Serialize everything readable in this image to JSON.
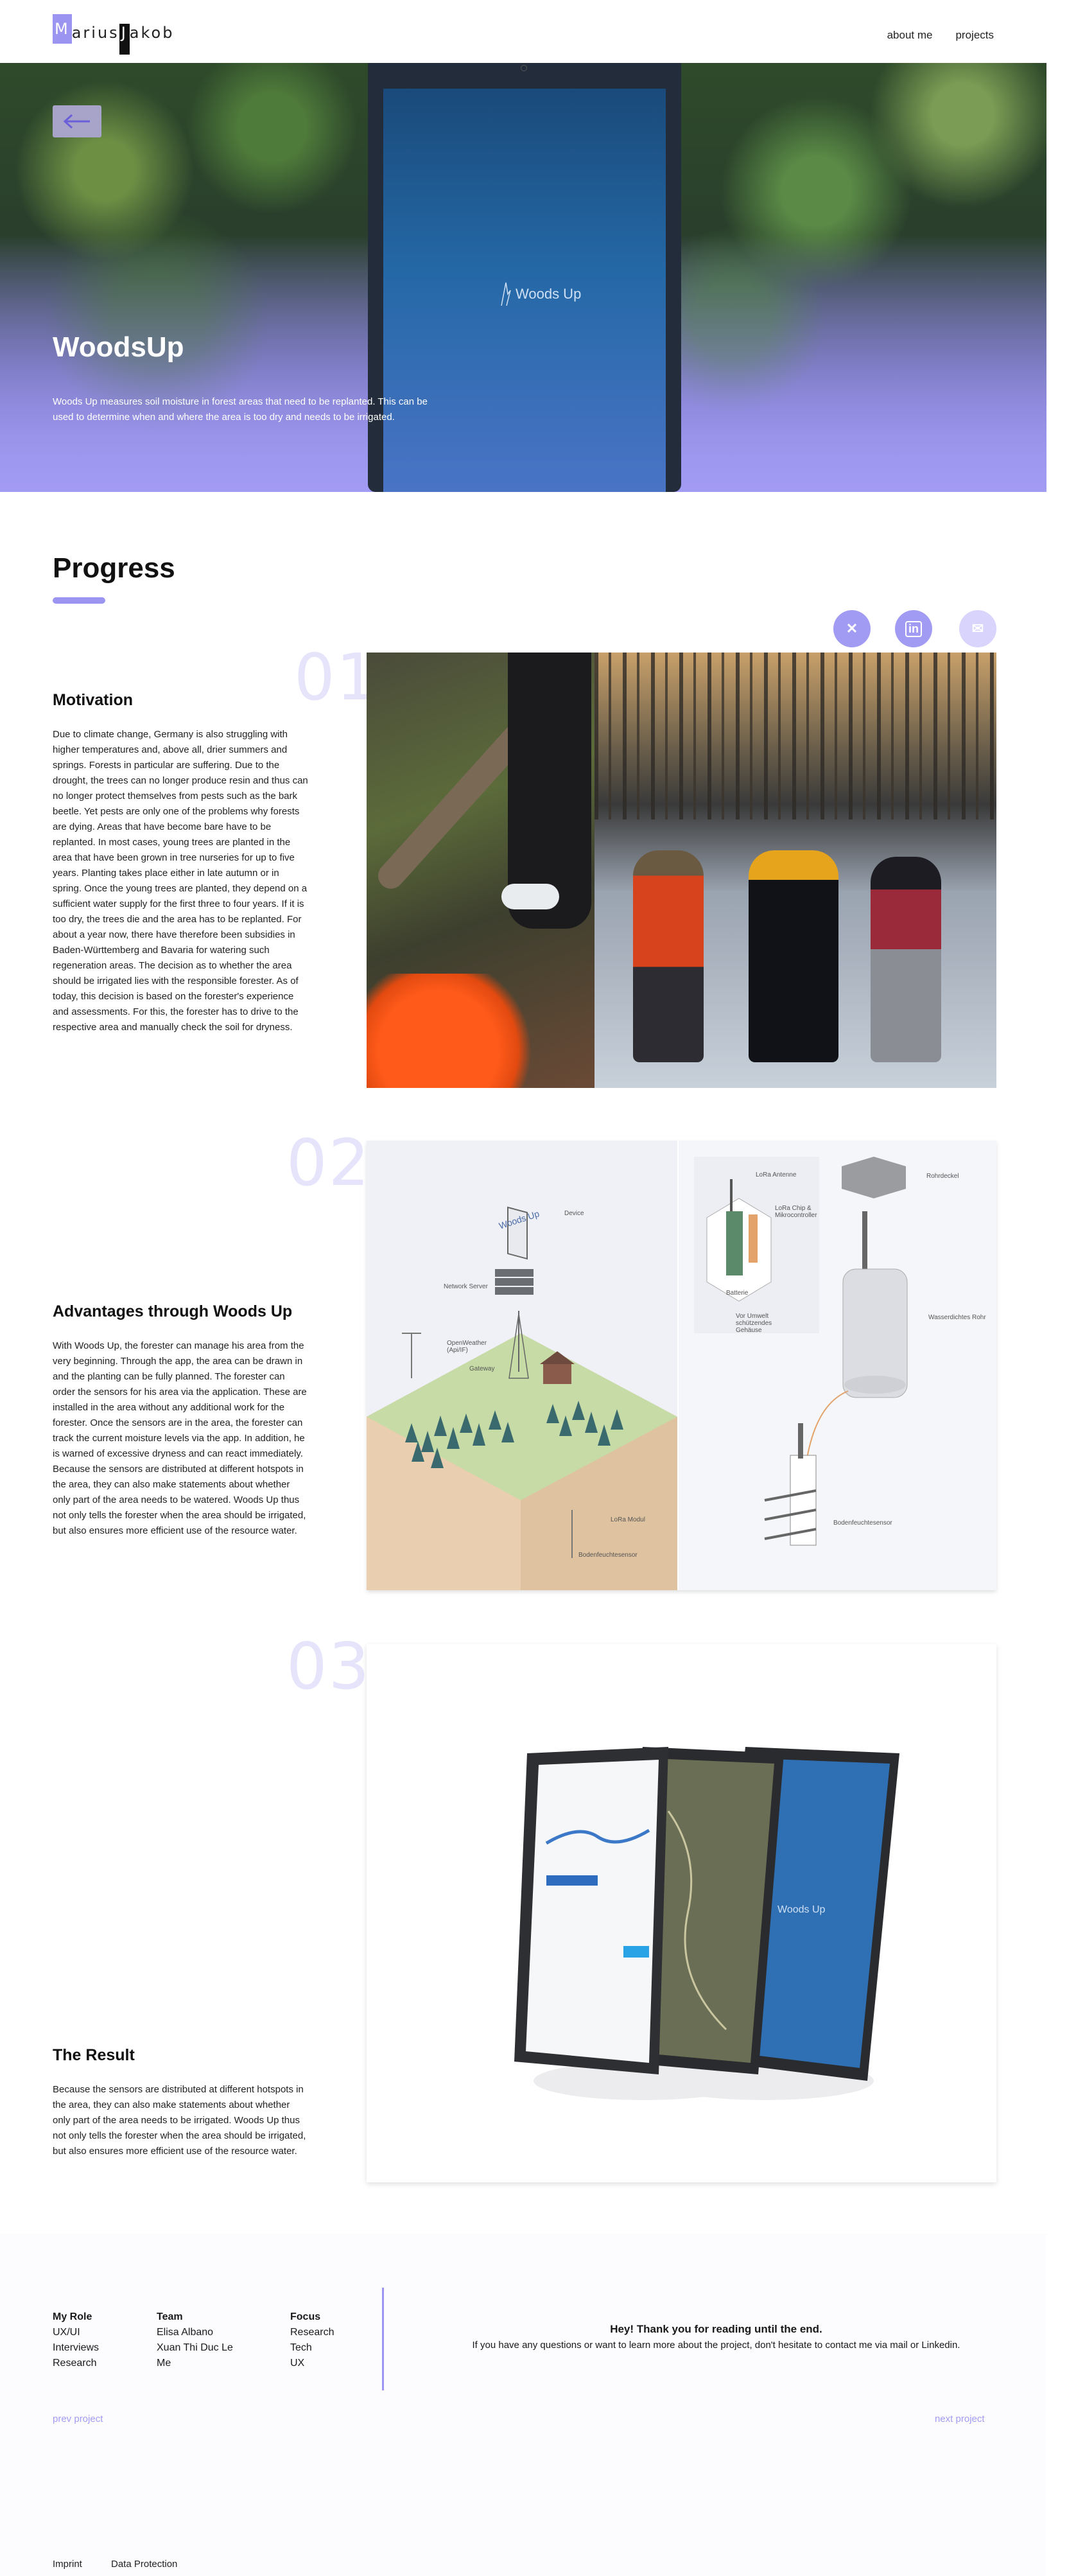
{
  "nav": {
    "logo_m": "M",
    "logo_middle": "arius ",
    "logo_j": "J",
    "logo_end": "akob",
    "links": [
      "about me",
      "projects"
    ]
  },
  "hero": {
    "back_icon": "arrow-left-icon",
    "title": "WoodsUp",
    "description": "Woods Up measures soil moisture in forest areas that need to be replanted. This can be used to determine when and where the area is too dry and needs to be irrigated.",
    "tablet_logo": "Woods Up"
  },
  "progress": {
    "title": "Progress",
    "social": [
      {
        "icon": "xing-icon",
        "glyph": "✕"
      },
      {
        "icon": "linkedin-icon",
        "glyph": "in"
      },
      {
        "icon": "mail-icon",
        "glyph": "✉"
      }
    ]
  },
  "sections": [
    {
      "number": "01",
      "title": "Motivation",
      "text": "Due to climate change, Germany is also struggling with higher temperatures and, above all, drier summers and springs. Forests in particular are suffering. Due to the drought, the trees can no longer produce resin and thus can no longer protect themselves from pests such as the bark beetle. Yet pests are only one of the problems why forests are dying. Areas that have become bare have to be replanted. In most cases, young trees are planted in the area that have been grown in tree nurseries for up to five years. Planting takes place either in late autumn or in spring. Once the young trees are planted, they depend on a sufficient water supply for the first three to four years. If it is too dry, the trees die and the area has to be replanted. For about a year now, there have therefore been subsidies in Baden-Württemberg and Bavaria for watering such regeneration areas. The decision as to whether the area should be irrigated lies with the responsible forester. As of today, this decision is based on the forester's experience and assessments. For this, the forester has to drive to the respective area and manually check the soil for dryness."
    },
    {
      "number": "02",
      "title": "Advantages through Woods Up",
      "text": "With Woods Up, the forester can manage his area from the very beginning. Through the app, the area can be drawn in and the planting can be fully planned. The forester can order the sensors for his area via the application. These are installed in the area without any additional work for the forester. Once the sensors are in the area, the forester can track the current moisture levels via the app. In addition, he is warned of excessive dryness and can react immediately. Because the sensors are distributed at different hotspots in the area, they can also make statements about whether only part of the area needs to be watered. Woods Up thus not only tells the forester when the area should be irrigated, but also ensures more efficient use of the resource water.",
      "diagram_labels": {
        "device": "Device",
        "network_server": "Network Server",
        "open_weather": "OpenWeather (Api/IF)",
        "gateway": "Gateway",
        "lora_modul": "LoRa Modul",
        "bodenfeuchtesensor": "Bodenfeuchtesensor",
        "lora_antenne": "LoRa Antenne",
        "lora_chip": "LoRa Chip & Mikrocontroller",
        "batterie": "Batterie",
        "gehaeuse": "Vor Umwelt schützendes Gehäuse",
        "rohrdeckel": "Rohrdeckel",
        "wasserdichtes_rohr": "Wasserdichtes Rohr",
        "bodenfeuchtesensor2": "Bodenfeuchtesensor",
        "woods_up": "Woods Up"
      }
    },
    {
      "number": "03",
      "title": "The Result",
      "text": "Because the sensors are distributed at different hotspots in the area, they can also make statements about whether only part of the area needs to be irrigated. Woods Up thus not only tells the forester when the area should be irrigated, but also ensures more efficient use of the resource water.",
      "tablet_logo": "Woods Up"
    }
  ],
  "footer": {
    "role": {
      "heading": "My Role",
      "items": [
        "UX/UI",
        "Interviews",
        "Research"
      ]
    },
    "team": {
      "heading": "Team",
      "items": [
        "Elisa Albano",
        "Xuan Thi Duc Le",
        "Me"
      ]
    },
    "focus": {
      "heading": "Focus",
      "items": [
        "Research",
        "Tech",
        "UX"
      ]
    },
    "thanks_title": "Hey! Thank you for reading until the end.",
    "thanks_text": "If you have any questions or want to learn more about the project, don't hesitate to contact me via mail or Linkedin.",
    "prev": "prev project",
    "next": "next project",
    "imprint": "Imprint",
    "privacy": "Data Protection"
  },
  "colors": {
    "accent": "#9b94f0",
    "accent_light": "#e6e4fb"
  }
}
